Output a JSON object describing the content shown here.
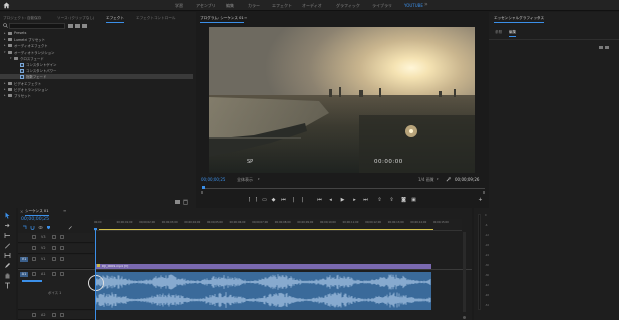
{
  "workspaces": [
    {
      "label": "学習",
      "active": false
    },
    {
      "label": "アセンブリ",
      "active": false
    },
    {
      "label": "編集",
      "active": false
    },
    {
      "label": "カラー",
      "active": false
    },
    {
      "label": "エフェクト",
      "active": false
    },
    {
      "label": "オーディオ",
      "active": false
    },
    {
      "label": "グラフィック",
      "active": false
    },
    {
      "label": "ライブラリ",
      "active": false
    },
    {
      "label": "YOUTUBE",
      "active": true
    }
  ],
  "left_panel": {
    "tabs": [
      "プロジェクト: 自動保存",
      "ソース: (クリップなし)",
      "エフェクト",
      "エフェクトコントロール"
    ],
    "active_tab": 2,
    "tree": [
      {
        "label": "Presets",
        "depth": 0,
        "expanded": false,
        "kind": "folder",
        "selected": false
      },
      {
        "label": "Lumetri プリセット",
        "depth": 0,
        "expanded": false,
        "kind": "folder",
        "selected": false
      },
      {
        "label": "オーディオエフェクト",
        "depth": 0,
        "expanded": false,
        "kind": "folder",
        "selected": false
      },
      {
        "label": "オーディオトランジション",
        "depth": 0,
        "expanded": true,
        "kind": "folder",
        "selected": false
      },
      {
        "label": "クロスフェード",
        "depth": 1,
        "expanded": true,
        "kind": "folder",
        "selected": false
      },
      {
        "label": "コンスタントゲイン",
        "depth": 2,
        "expanded": false,
        "kind": "effect",
        "selected": false
      },
      {
        "label": "コンスタントパワー",
        "depth": 2,
        "expanded": false,
        "kind": "effect",
        "selected": false
      },
      {
        "label": "指数フェード",
        "depth": 2,
        "expanded": false,
        "kind": "effect",
        "selected": true
      },
      {
        "label": "ビデオエフェクト",
        "depth": 0,
        "expanded": false,
        "kind": "folder",
        "selected": false
      },
      {
        "label": "ビデオトランジション",
        "depth": 0,
        "expanded": false,
        "kind": "folder",
        "selected": false
      },
      {
        "label": "プリセット",
        "depth": 0,
        "expanded": false,
        "kind": "folder",
        "selected": false
      }
    ]
  },
  "program": {
    "title": "プログラム: シーケンス 01",
    "overlay_left": "SP",
    "overlay_right": "00:00:00",
    "current_tc": "00;00;00;25",
    "fit_label": "全体表示",
    "quality_label": "1/4 画質",
    "duration_tc": "00;00;09;26"
  },
  "right_panel": {
    "title": "エッセンシャルグラフィックス",
    "tabs": [
      "参照",
      "編集"
    ],
    "active_tab": 1
  },
  "timeline": {
    "tab": "シーケンス 01",
    "timecode": "00;00;00;25",
    "ruler": [
      "00;00",
      "00;00;01;00",
      "00;00;02;00",
      "00;00;03;00",
      "00;00;04;00",
      "00;00;05;00",
      "00;00;06;00",
      "00;00;07;00",
      "00;00;08;00",
      "00;00;09;00",
      "00;00;10;00",
      "00;00;11;00",
      "00;00;12;00",
      "00;00;13;00",
      "00;00;14;00",
      "00;00;15;00"
    ],
    "video_tracks": [
      "V3",
      "V2",
      "V1"
    ],
    "audio_tracks": [
      "A1",
      "A2"
    ],
    "v1_source": "V1",
    "a1_source": "A1",
    "clip_label": "DJI_0009.mp4 [V]",
    "audio_sub": "ボイス 1",
    "colors": {
      "clip_video": "#7a69b0",
      "clip_audio": "#3a6a9a",
      "accent": "#3b8fe8",
      "playhead": "#3b8fe8"
    }
  },
  "meter": {
    "scale": [
      "0",
      "-6",
      "-12",
      "-18",
      "-24",
      "-30",
      "-36",
      "-42",
      "-48",
      "-54"
    ]
  },
  "icons": [
    "home-icon",
    "expand-icon",
    "search-icon",
    "new-bin-icon",
    "wrench-icon",
    "play-icon",
    "step-back-icon",
    "step-forward-icon",
    "add-icon",
    "selection-tool-icon",
    "razor-tool-icon",
    "hand-tool-icon",
    "text-tool-icon"
  ]
}
